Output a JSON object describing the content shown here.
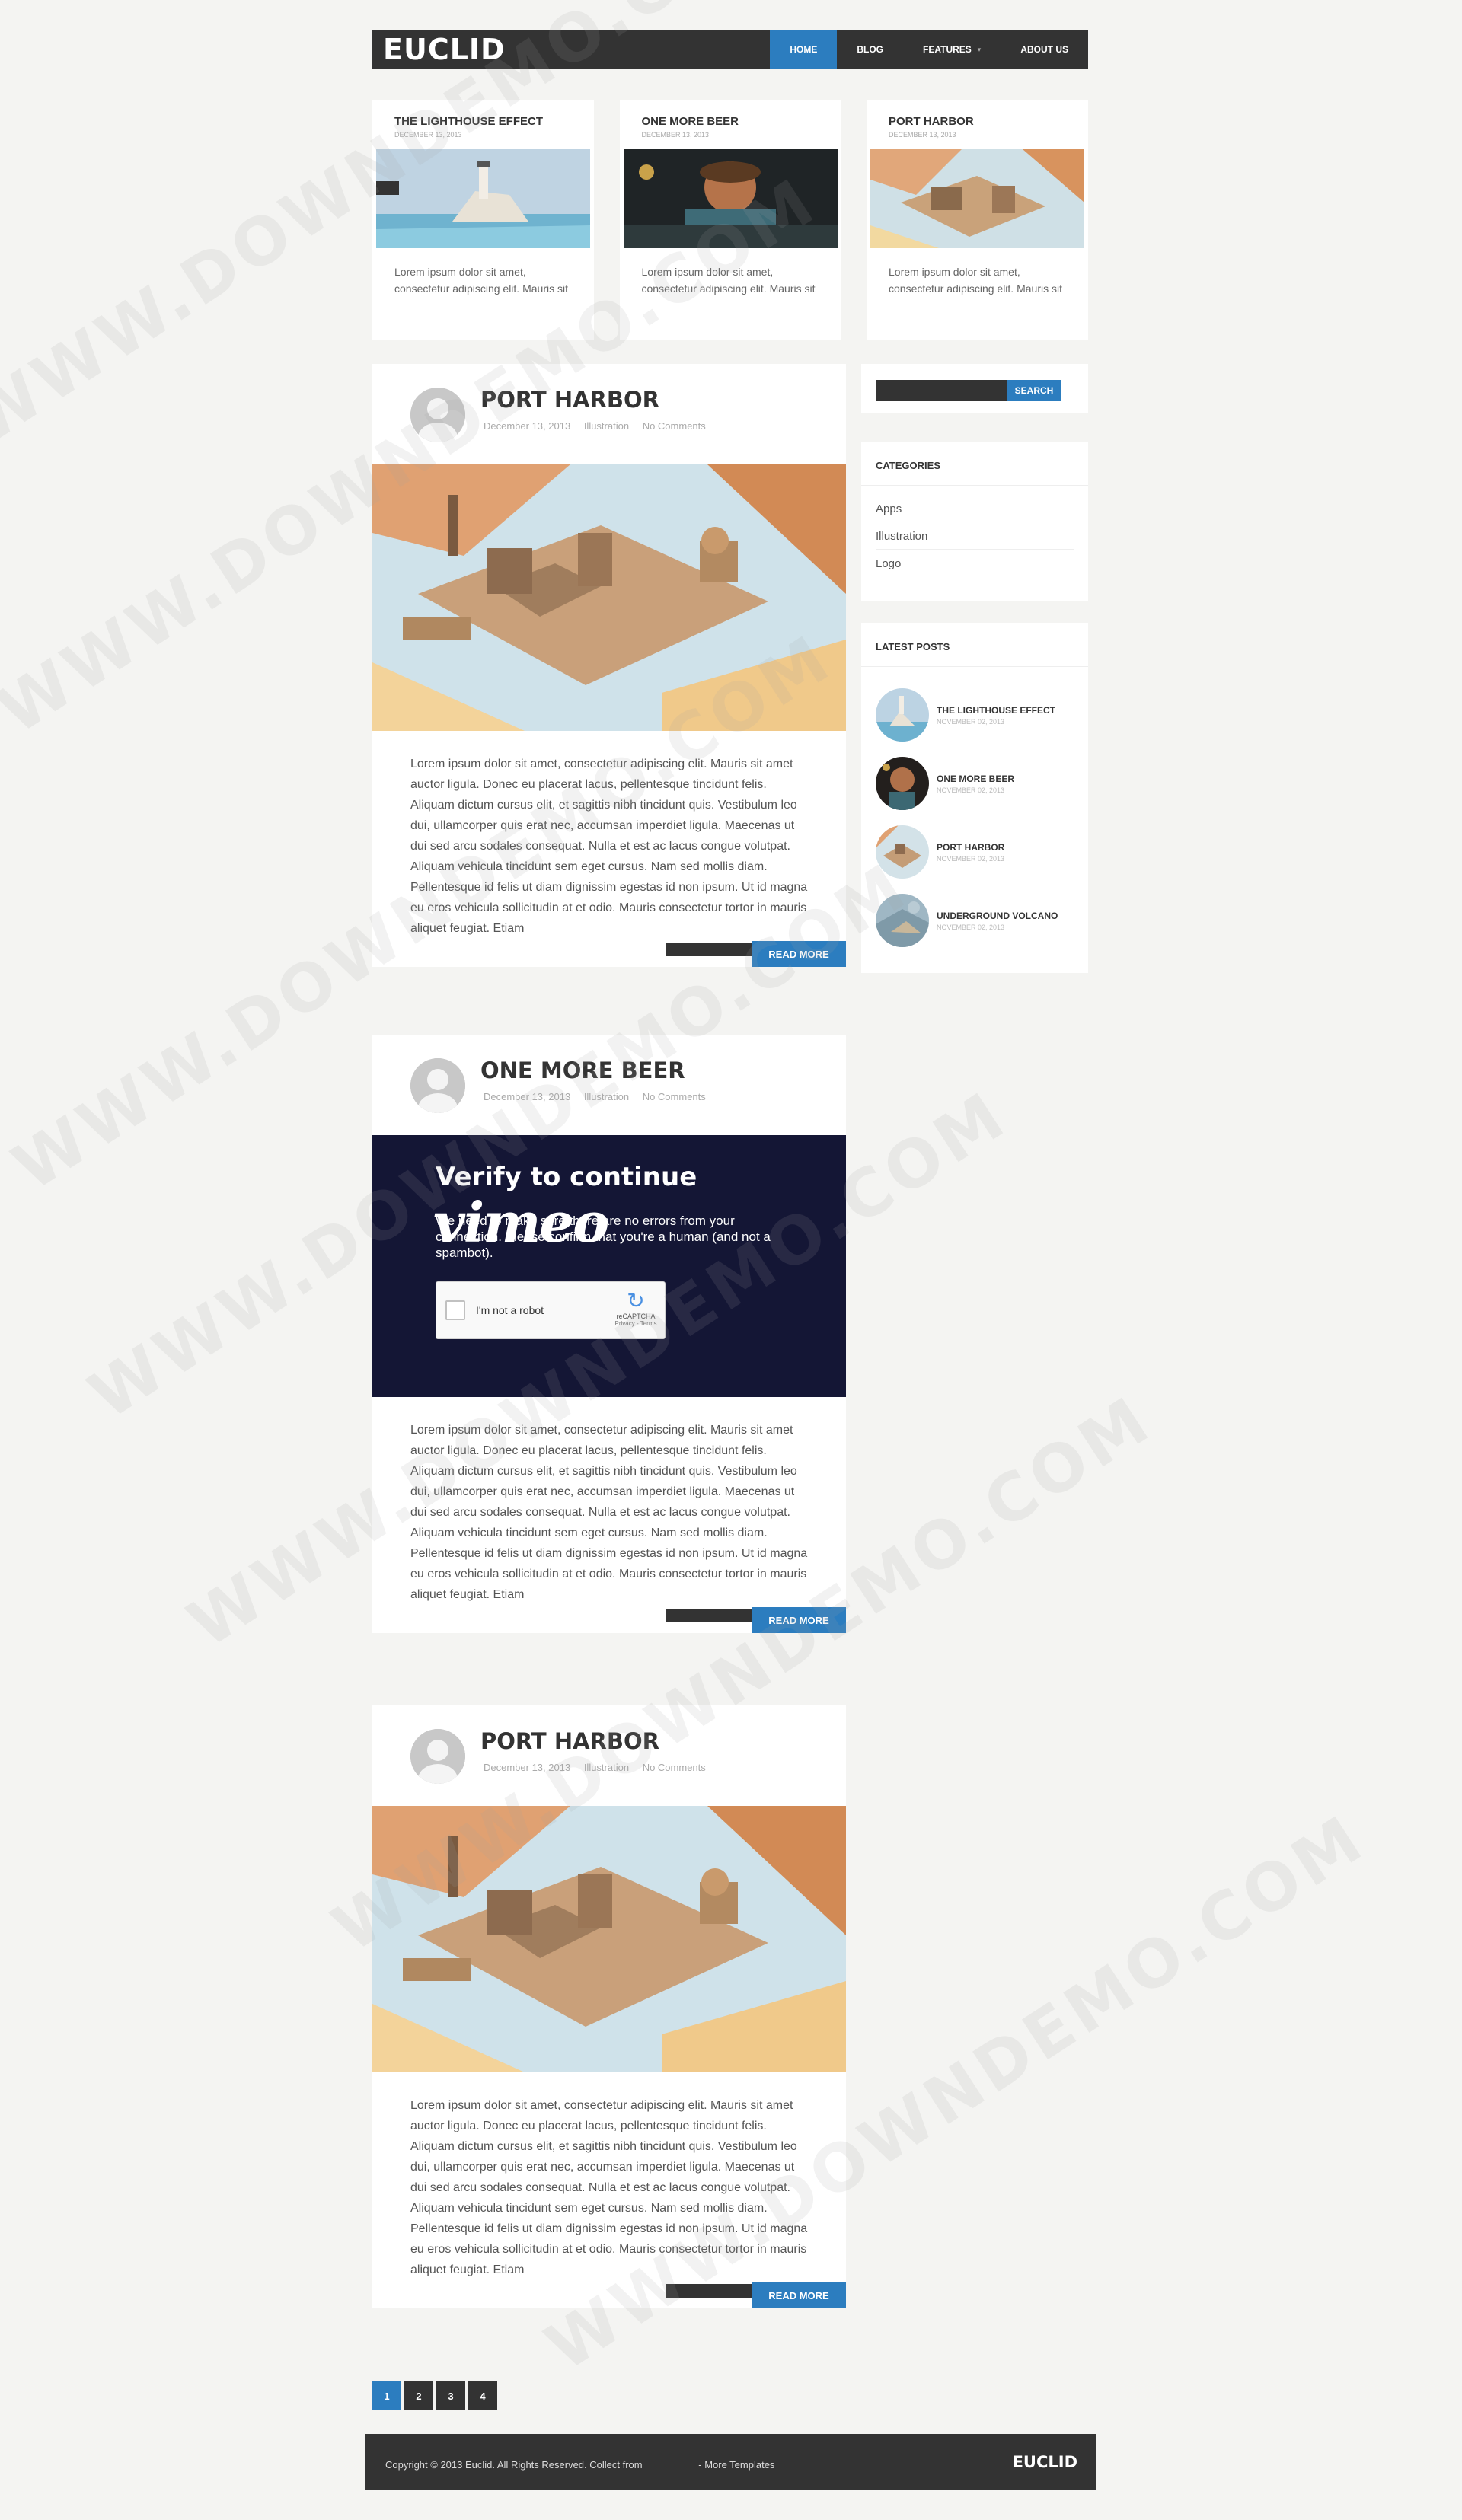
{
  "site": {
    "logo": "EUCLID"
  },
  "nav": [
    {
      "label": "HOME",
      "active": true
    },
    {
      "label": "BLOG",
      "active": false
    },
    {
      "label": "FEATURES",
      "active": false,
      "caret": "▾"
    },
    {
      "label": "ABOUT US",
      "active": false
    }
  ],
  "featured": [
    {
      "title": "THE LIGHTHOUSE EFFECT",
      "date": "DECEMBER 13, 2013",
      "image": "lighthouse",
      "excerpt": "Lorem ipsum dolor sit amet, consectetur adipiscing elit. Mauris sit amet auctor ligula. Donec eu"
    },
    {
      "title": "ONE MORE BEER",
      "date": "DECEMBER 13, 2013",
      "image": "beer",
      "excerpt": "Lorem ipsum dolor sit amet, consectetur adipiscing elit. Mauris sit amet auctor ligula. Donec eu"
    },
    {
      "title": "PORT HARBOR",
      "date": "DECEMBER 13, 2013",
      "image": "harbor",
      "excerpt": "Lorem ipsum dolor sit amet, consectetur adipiscing elit. Mauris sit amet auctor ligula. Donec eu"
    }
  ],
  "posts": [
    {
      "title": "PORT HARBOR",
      "date": "December 13, 2013",
      "category": "Illustration",
      "comments": "No Comments",
      "media": "harbor-image"
    },
    {
      "title": "ONE MORE BEER",
      "date": "December 13, 2013",
      "category": "Illustration",
      "comments": "No Comments",
      "media": "vimeo-embed"
    },
    {
      "title": "PORT HARBOR",
      "date": "December 13, 2013",
      "category": "Illustration",
      "comments": "No Comments",
      "media": "harbor-image"
    }
  ],
  "post_body": "Lorem ipsum dolor sit amet, consectetur adipiscing elit. Mauris sit amet auctor ligula. Donec eu placerat lacus, pellentesque tincidunt felis. Aliquam dictum cursus elit, et sagittis nibh tincidunt quis. Vestibulum leo dui, ullamcorper quis erat nec, accumsan imperdiet ligula. Maecenas ut dui sed arcu sodales consequat. Nulla et est ac lacus congue volutpat. Aliquam vehicula tincidunt sem eget cursus. Nam sed mollis diam. Pellentesque id felis ut diam dignissim egestas id non ipsum. Ut id magna eu eros vehicula sollicitudin at et odio. Mauris consectetur tortor in mauris aliquet feugiat. Etiam",
  "read_more": "READ MORE",
  "vimeo": {
    "title": "Verify to continue",
    "text": "We need to make sure there are no errors from your connection. Please confirm that you're a human (and not a spambot).",
    "logo": "vimeo",
    "captcha_label": "I'm not a robot",
    "captcha_brand": "reCAPTCHA",
    "captcha_links": "Privacy - Terms"
  },
  "sidebar": {
    "search_button": "SEARCH",
    "categories_title": "CATEGORIES",
    "categories": [
      "Apps",
      "Illustration",
      "Logo"
    ],
    "latest_title": "LATEST POSTS",
    "latest": [
      {
        "title": "THE LIGHTHOUSE EFFECT",
        "date": "NOVEMBER 02, 2013",
        "image": "lighthouse"
      },
      {
        "title": "ONE MORE BEER",
        "date": "NOVEMBER 02, 2013",
        "image": "beer"
      },
      {
        "title": "PORT HARBOR",
        "date": "NOVEMBER 02, 2013",
        "image": "harbor"
      },
      {
        "title": "UNDERGROUND VOLCANO",
        "date": "NOVEMBER 02, 2013",
        "image": "volcano"
      }
    ]
  },
  "pagination": [
    {
      "label": "1",
      "active": true
    },
    {
      "label": "2",
      "active": false
    },
    {
      "label": "3",
      "active": false
    },
    {
      "label": "4",
      "active": false
    }
  ],
  "footer": {
    "copyright": "Copyright © 2013 Euclid. All Rights Reserved. Collect from",
    "link": "- More Templates",
    "logo": "EUCLID"
  },
  "watermark": "WWW.DOWNDEMO.COM",
  "colors": {
    "accent": "#2c7dbf",
    "dark": "#333333",
    "vimeo_bg": "#141635",
    "page_bg": "#f4f4f2"
  }
}
